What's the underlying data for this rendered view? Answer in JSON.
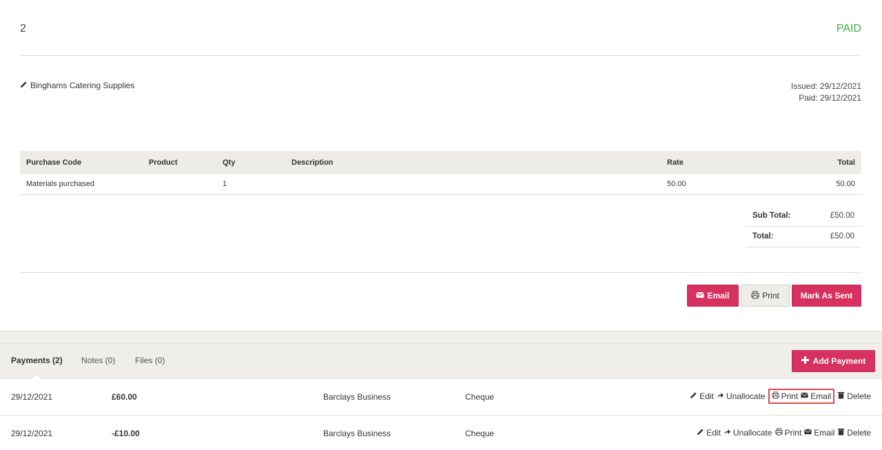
{
  "invoice": {
    "number": "2",
    "status": "PAID",
    "status_color": "#3cb04a",
    "client": "Binghams Catering Supplies",
    "issued": "Issued: 29/12/2021",
    "paid": "Paid: 29/12/2021"
  },
  "items_table": {
    "headers": [
      "Purchase Code",
      "Product",
      "Qty",
      "Description",
      "Rate",
      "Total"
    ],
    "rows": [
      {
        "purchase_code": "Materials purchased",
        "product": "",
        "qty": "1",
        "description": "",
        "rate": "50.00",
        "total": "50.00"
      }
    ]
  },
  "totals": {
    "subtotal_label": "Sub Total:",
    "subtotal_value": "£50.00",
    "total_label": "Total:",
    "total_value": "£50.00"
  },
  "actions": {
    "email": "Email",
    "print": "Print",
    "mark_sent": "Mark As Sent"
  },
  "tabs": [
    {
      "label": "Payments (2)",
      "active": true
    },
    {
      "label": "Notes (0)",
      "active": false
    },
    {
      "label": "Files (0)",
      "active": false
    }
  ],
  "add_payment_label": "Add Payment",
  "payments": [
    {
      "date": "29/12/2021",
      "amount": "£60.00",
      "account": "Barclays Business",
      "method": "Cheque"
    },
    {
      "date": "29/12/2021",
      "amount": "-£10.00",
      "account": "Barclays Business",
      "method": "Cheque"
    }
  ],
  "row_actions": {
    "edit": "Edit",
    "unallocate": "Unallocate",
    "print": "Print",
    "email": "Email",
    "delete": "Delete"
  },
  "accent_color": "#d6315f"
}
